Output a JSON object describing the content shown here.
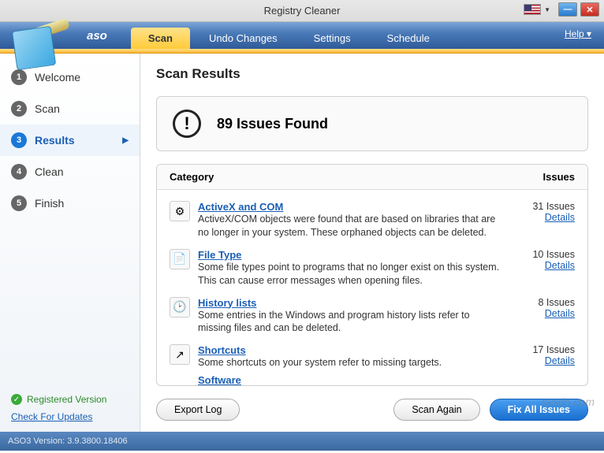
{
  "window": {
    "title": "Registry Cleaner"
  },
  "brand": "aso",
  "tabs": [
    {
      "label": "Scan",
      "active": true
    },
    {
      "label": "Undo Changes",
      "active": false
    },
    {
      "label": "Settings",
      "active": false
    },
    {
      "label": "Schedule",
      "active": false
    }
  ],
  "help_label": "Help",
  "sidebar": {
    "steps": [
      {
        "num": "1",
        "label": "Welcome"
      },
      {
        "num": "2",
        "label": "Scan"
      },
      {
        "num": "3",
        "label": "Results",
        "active": true
      },
      {
        "num": "4",
        "label": "Clean"
      },
      {
        "num": "5",
        "label": "Finish"
      }
    ],
    "registered": "Registered Version",
    "updates": "Check For Updates"
  },
  "main": {
    "heading": "Scan Results",
    "summary": "89 Issues Found",
    "col_category": "Category",
    "col_issues": "Issues",
    "categories": [
      {
        "title": "ActiveX and COM",
        "desc": "ActiveX/COM objects were found that are based on libraries that are no longer in your system. These orphaned objects can be deleted.",
        "count": "31 Issues",
        "details": "Details",
        "icon": "⚙"
      },
      {
        "title": "File Type",
        "desc": "Some file types point to programs that no longer exist on this system. This can cause error messages when opening files.",
        "count": "10 Issues",
        "details": "Details",
        "icon": "📄"
      },
      {
        "title": "History lists",
        "desc": "Some entries in the Windows and program history lists refer to missing files and can be deleted.",
        "count": "8 Issues",
        "details": "Details",
        "icon": "🕑"
      },
      {
        "title": "Shortcuts",
        "desc": "Some shortcuts on your system refer to missing targets.",
        "count": "17 Issues",
        "details": "Details",
        "icon": "↗"
      }
    ],
    "software_link": "Software",
    "buttons": {
      "export": "Export Log",
      "scan_again": "Scan Again",
      "fix_all": "Fix All Issues"
    }
  },
  "statusbar": "ASO3 Version: 3.9.3800.18406",
  "watermark": "sysdn.com"
}
